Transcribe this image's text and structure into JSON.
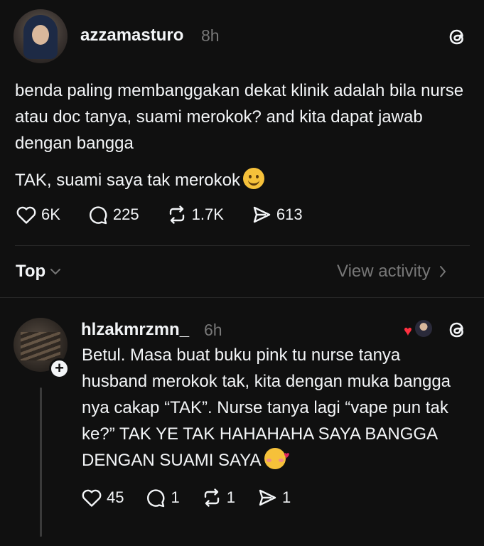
{
  "post": {
    "username": "azzamasturo",
    "time": "8h",
    "text_lines": [
      "benda paling membanggakan dekat klinik adalah bila nurse atau doc tanya, suami merokok? and kita dapat jawab dengan bangga"
    ],
    "text2": "TAK, suami saya tak merokok",
    "emoji": "smiling-face-icon",
    "likes": "6K",
    "comments": "225",
    "reposts": "1.7K",
    "shares": "613"
  },
  "sort": {
    "label": "Top",
    "view_activity": "View activity"
  },
  "reply": {
    "username": "hlzakmrzmn_",
    "time": "6h",
    "text": "Betul. Masa buat buku pink tu nurse tanya husband merokok tak, kita dengan muka bangga nya cakap “TAK”. Nurse tanya lagi “vape pun tak ke?” TAK YE TAK HAHAHAHA SAYA BANGGA DENGAN SUAMI SAYA",
    "emoji": "smiling-face-with-hearts-icon",
    "likes": "45",
    "comments": "1",
    "reposts": "1",
    "shares": "1"
  },
  "icons": {
    "like": "heart-icon",
    "comment": "comment-bubble-icon",
    "repost": "repost-icon",
    "share": "send-icon",
    "threads": "threads-logo-icon"
  }
}
